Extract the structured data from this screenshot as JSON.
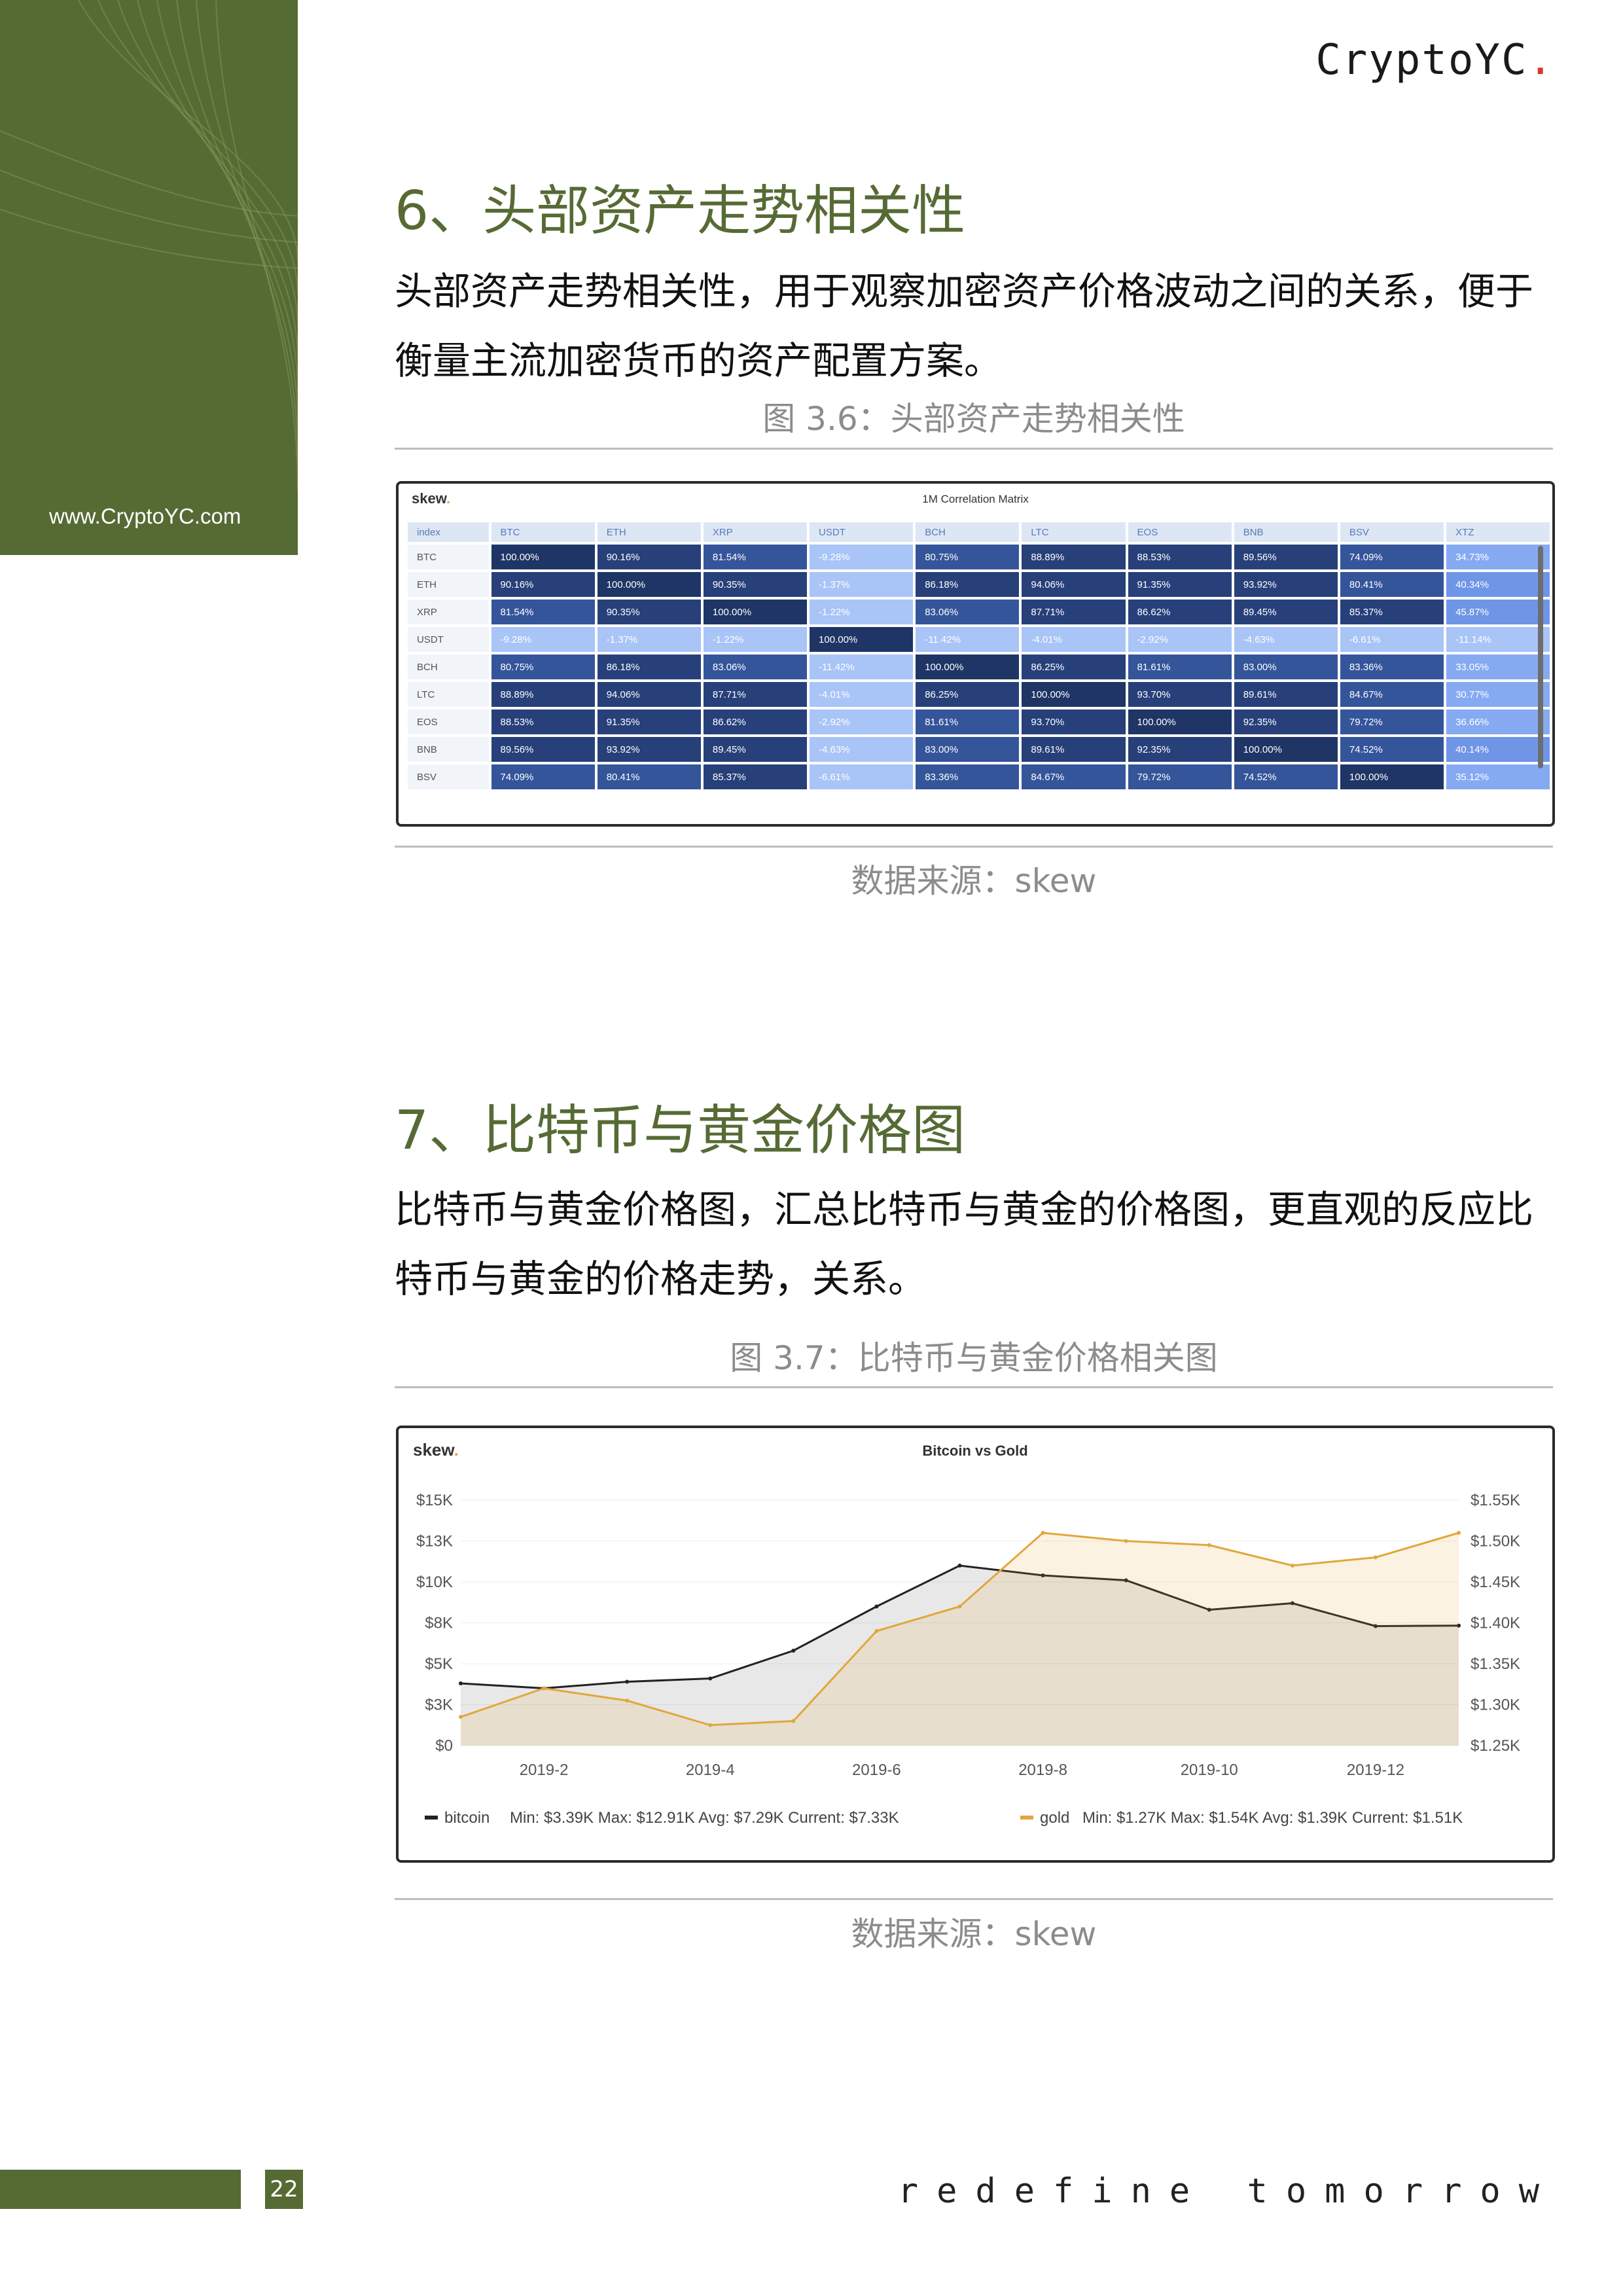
{
  "header": {
    "brand": "CryptoYC",
    "brand_dot": "."
  },
  "sidebar": {
    "url": "www.CryptoYC.com"
  },
  "section6": {
    "title": "6、头部资产走势相关性",
    "paragraph": "头部资产走势相关性，用于观察加密资产价格波动之间的关系，便于衡量主流加密货币的资产配置方案。",
    "caption": "图 3.6：头部资产走势相关性",
    "source": "数据来源：skew"
  },
  "matrix": {
    "logo": "skew",
    "logo_dot": ".",
    "title": "1M Correlation Matrix",
    "columns": [
      "index",
      "BTC",
      "ETH",
      "XRP",
      "USDT",
      "BCH",
      "LTC",
      "EOS",
      "BNB",
      "BSV",
      "XTZ"
    ],
    "rows": [
      {
        "label": "BTC",
        "values": [
          "100.00%",
          "90.16%",
          "81.54%",
          "-9.28%",
          "80.75%",
          "88.89%",
          "88.53%",
          "89.56%",
          "74.09%",
          "34.73%"
        ]
      },
      {
        "label": "ETH",
        "values": [
          "90.16%",
          "100.00%",
          "90.35%",
          "-1.37%",
          "86.18%",
          "94.06%",
          "91.35%",
          "93.92%",
          "80.41%",
          "40.34%"
        ]
      },
      {
        "label": "XRP",
        "values": [
          "81.54%",
          "90.35%",
          "100.00%",
          "-1.22%",
          "83.06%",
          "87.71%",
          "86.62%",
          "89.45%",
          "85.37%",
          "45.87%"
        ]
      },
      {
        "label": "USDT",
        "values": [
          "-9.28%",
          "-1.37%",
          "-1.22%",
          "100.00%",
          "-11.42%",
          "-4.01%",
          "-2.92%",
          "-4.63%",
          "-6.61%",
          "-11.14%"
        ]
      },
      {
        "label": "BCH",
        "values": [
          "80.75%",
          "86.18%",
          "83.06%",
          "-11.42%",
          "100.00%",
          "86.25%",
          "81.61%",
          "83.00%",
          "83.36%",
          "33.05%"
        ]
      },
      {
        "label": "LTC",
        "values": [
          "88.89%",
          "94.06%",
          "87.71%",
          "-4.01%",
          "86.25%",
          "100.00%",
          "93.70%",
          "89.61%",
          "84.67%",
          "30.77%"
        ]
      },
      {
        "label": "EOS",
        "values": [
          "88.53%",
          "91.35%",
          "86.62%",
          "-2.92%",
          "81.61%",
          "93.70%",
          "100.00%",
          "92.35%",
          "79.72%",
          "36.66%"
        ]
      },
      {
        "label": "BNB",
        "values": [
          "89.56%",
          "93.92%",
          "89.45%",
          "-4.63%",
          "83.00%",
          "89.61%",
          "92.35%",
          "100.00%",
          "74.52%",
          "40.14%"
        ]
      },
      {
        "label": "BSV",
        "values": [
          "74.09%",
          "80.41%",
          "85.37%",
          "-6.61%",
          "83.36%",
          "84.67%",
          "79.72%",
          "74.52%",
          "100.00%",
          "35.12%"
        ]
      }
    ]
  },
  "section7": {
    "title": "7、比特币与黄金价格图",
    "paragraph": "比特币与黄金价格图，汇总比特币与黄金的价格图，更直观的反应比特币与黄金的价格走势，关系。",
    "caption": "图 3.7：比特币与黄金价格相关图",
    "source": "数据来源：skew"
  },
  "chart_data": {
    "type": "area",
    "title": "Bitcoin vs Gold",
    "logo": "skew",
    "logo_dot": ".",
    "x": [
      "2019-01",
      "2019-02",
      "2019-03",
      "2019-04",
      "2019-05",
      "2019-06",
      "2019-07",
      "2019-08",
      "2019-09",
      "2019-10",
      "2019-11",
      "2019-12",
      "2020-01"
    ],
    "x_ticks": [
      "2019-2",
      "2019-4",
      "2019-6",
      "2019-8",
      "2019-10",
      "2019-12"
    ],
    "y_left_ticks": [
      "$0",
      "$3K",
      "$5K",
      "$8K",
      "$10K",
      "$13K",
      "$15K"
    ],
    "y_right_ticks": [
      "$1.25K",
      "$1.30K",
      "$1.35K",
      "$1.40K",
      "$1.45K",
      "$1.50K",
      "$1.55K"
    ],
    "ylim_left": [
      0,
      15000
    ],
    "ylim_right": [
      1250,
      1550
    ],
    "series": [
      {
        "name": "bitcoin",
        "axis": "left",
        "color": "#222222",
        "values": [
          3800,
          3500,
          3900,
          4100,
          5800,
          8500,
          11000,
          10400,
          10100,
          8300,
          8700,
          7300,
          7330
        ],
        "legend": "Min: $3.39K  Max: $12.91K  Avg: $7.29K  Current: $7.33K"
      },
      {
        "name": "gold",
        "axis": "right",
        "color": "#e1a73c",
        "values": [
          1285,
          1320,
          1305,
          1275,
          1280,
          1390,
          1420,
          1510,
          1500,
          1495,
          1470,
          1480,
          1510
        ],
        "legend": "Min: $1.27K  Max: $1.54K  Avg: $1.39K  Current: $1.51K"
      }
    ]
  },
  "footer": {
    "page": "22",
    "tagline": "redefine tomorrow"
  }
}
